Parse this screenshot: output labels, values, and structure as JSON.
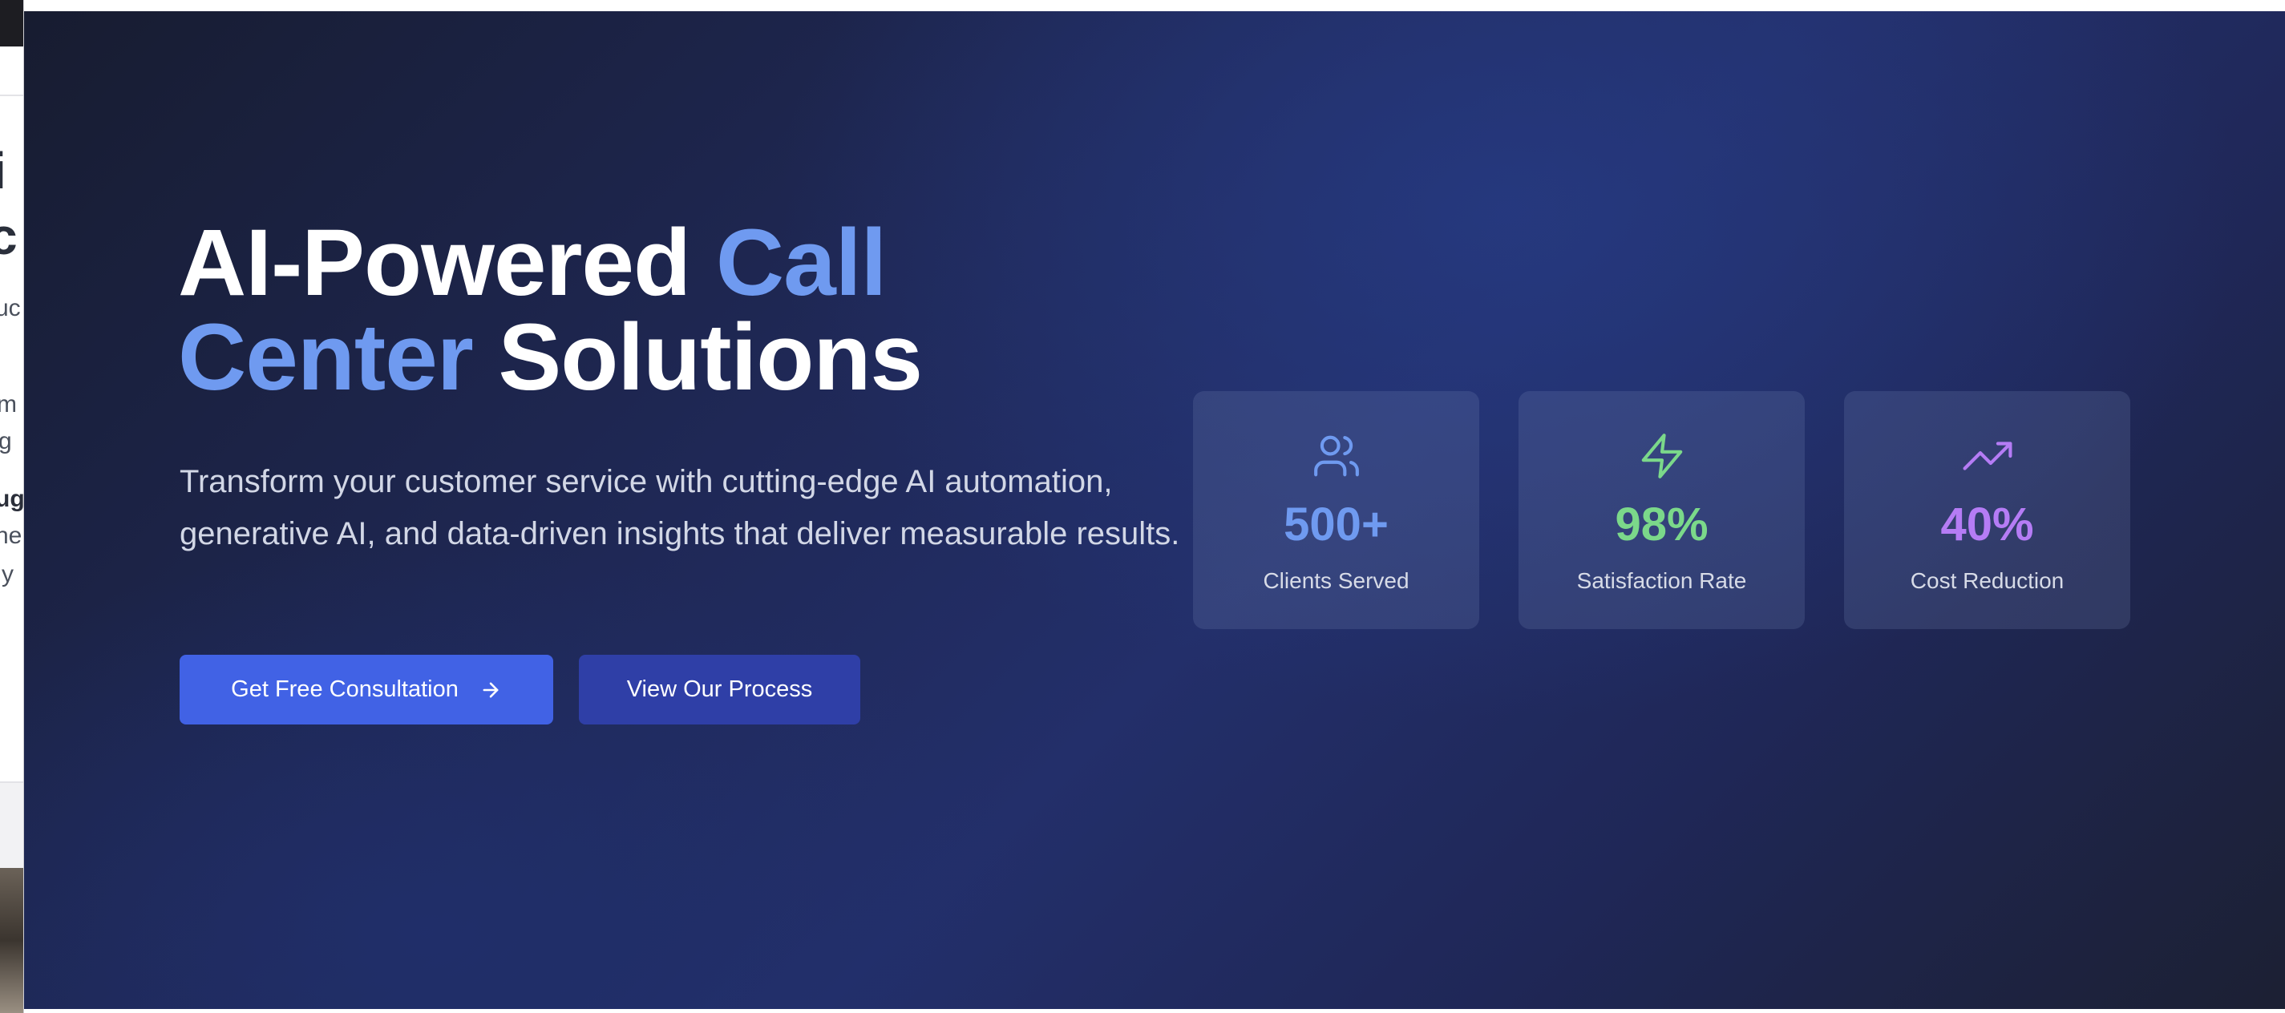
{
  "background_window": {
    "fragments": [
      "i",
      "c",
      "uc",
      "m",
      "g",
      "ug",
      "he",
      "y"
    ]
  },
  "hero": {
    "headline": {
      "part1": "AI-Powered ",
      "accent1": "Call",
      "accent2": "Center",
      "part2": " Solutions"
    },
    "subtitle": "Transform your customer service with cutting-edge AI automation, generative AI, and data-driven insights that deliver measurable results.",
    "buttons": {
      "primary_label": "Get Free Consultation",
      "primary_icon": "arrow-right-icon",
      "secondary_label": "View Our Process"
    },
    "stats": [
      {
        "icon": "users-icon",
        "value": "500+",
        "label": "Clients Served",
        "color": "#6f9af0"
      },
      {
        "icon": "zap-icon",
        "value": "98%",
        "label": "Satisfaction Rate",
        "color": "#7bd88a"
      },
      {
        "icon": "trending-up-icon",
        "value": "40%",
        "label": "Cost Reduction",
        "color": "#b57cf5"
      }
    ]
  },
  "colors": {
    "accent_blue": "#6f9af0",
    "primary_button": "#4162e5",
    "secondary_button": "#2f3fa7",
    "background_dark": "#1c2140"
  }
}
